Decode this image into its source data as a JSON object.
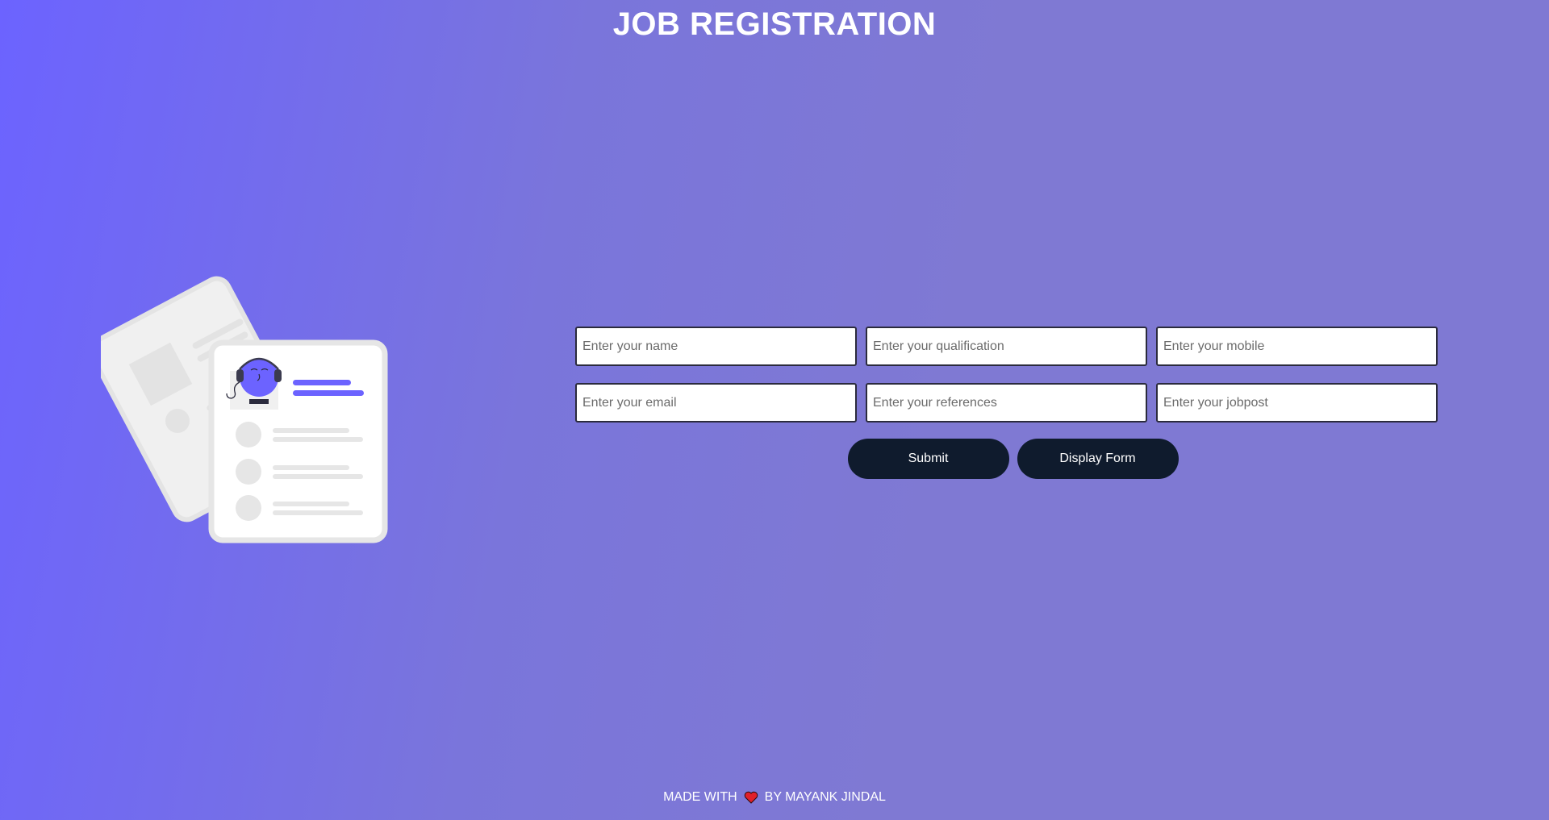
{
  "header": {
    "title": "JOB REGISTRATION"
  },
  "form": {
    "row1": {
      "name_placeholder": "Enter your name",
      "qualification_placeholder": "Enter your qualification",
      "mobile_placeholder": "Enter your mobile"
    },
    "row2": {
      "email_placeholder": "Enter your email",
      "references_placeholder": "Enter your references",
      "jobpost_placeholder": "Enter your jobpost"
    },
    "submit_label": "Submit",
    "display_label": "Display Form"
  },
  "footer": {
    "made_with": "MADE WITH",
    "by_text": "BY MAYANK JINDAL",
    "icon": "heart-icon"
  },
  "colors": {
    "background_start": "#6c63ff",
    "background_end": "#7f79d3",
    "button_bg": "#0f1b2d",
    "accent": "#6c63ff",
    "heart": "#e0202a"
  }
}
